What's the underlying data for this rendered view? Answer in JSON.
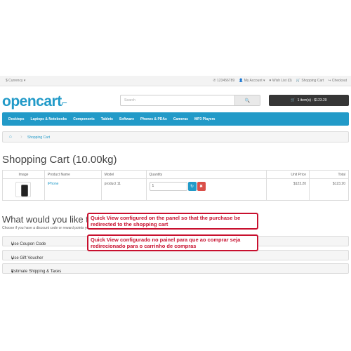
{
  "topbar": {
    "currency": "$ Currency",
    "phone": "123456789",
    "my_account": "My Account",
    "wish_list": "Wish List (0)",
    "shopping_cart": "Shopping Cart",
    "checkout": "Checkout"
  },
  "header": {
    "logo": "opencart",
    "search_placeholder": "Search",
    "cart_button": "1 item(s) - $123.20"
  },
  "menu": {
    "items": [
      "Desktops",
      "Laptops & Notebooks",
      "Components",
      "Tablets",
      "Software",
      "Phones & PDAs",
      "Cameras",
      "MP3 Players"
    ]
  },
  "breadcrumb": {
    "crumb": "Shopping Cart"
  },
  "page": {
    "title": "Shopping Cart  (10.00kg)"
  },
  "cart_table": {
    "headers": [
      "Image",
      "Product Name",
      "Model",
      "Quantity",
      "Unit Price",
      "Total"
    ],
    "rows": [
      {
        "name": "iPhone",
        "model": "product 11",
        "quantity": "1",
        "unit_price": "$123.20",
        "total": "$123.20"
      }
    ]
  },
  "next": {
    "title": "What would you like to",
    "desc": "Choose if you have a discount code or reward points you want to use"
  },
  "panels": [
    "Use Coupon Code",
    "Use Gift Voucher",
    "Estimate Shipping & Taxes"
  ],
  "annotations": {
    "english": "Quick View configured on the panel so that the purchase be redirected to the shopping cart",
    "portuguese": "Quick View configurado no painel para que ao comprar seja redirecionado para o carrinho de compras"
  },
  "colors": {
    "brand_blue": "#229ac8",
    "danger": "#da4f49",
    "dark": "#363636",
    "annotation": "#c8102e"
  }
}
